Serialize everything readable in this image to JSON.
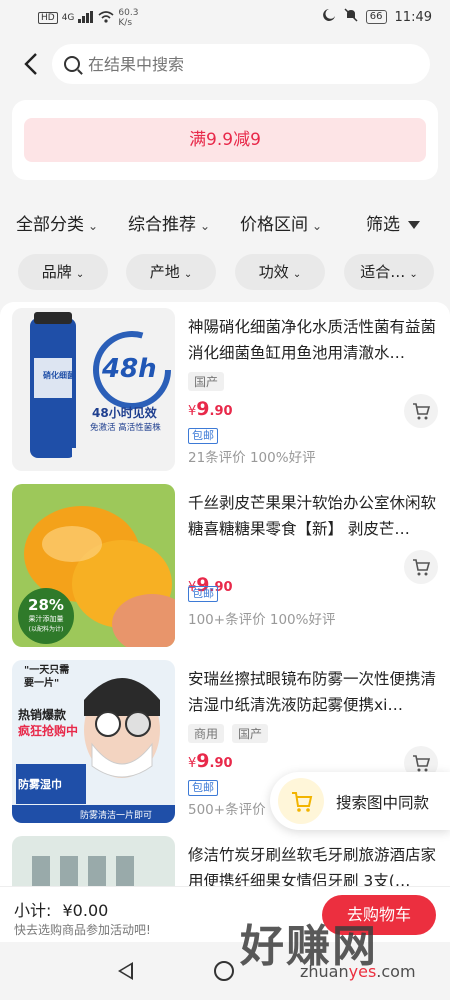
{
  "status_bar": {
    "network": "HD",
    "signal": "4G",
    "speed": "60.3",
    "speed_unit": "K/s",
    "battery": "66",
    "time": "11:49"
  },
  "search": {
    "placeholder": "在结果中搜索"
  },
  "promo_banner": "满9.9减9",
  "sort": {
    "category": "全部分类",
    "recommend": "综合推荐",
    "price_range": "价格区间",
    "filter": "筛选"
  },
  "chips": [
    "品牌",
    "产地",
    "功效",
    "适合…"
  ],
  "products": [
    {
      "title": "神陽硝化细菌净化水质活性菌有益菌消化细菌鱼缸用鱼池用清澈水…",
      "tags": [
        "国产"
      ],
      "price_yen": "¥",
      "price_int": "9",
      "price_dec": ".90",
      "shipping": "包邮",
      "reviews": "21条评价  100%好评",
      "image_text": {
        "badge": "48h",
        "caption": "48小时见效",
        "sub": "免激活  高活性菌株",
        "can": "硝化细菌"
      }
    },
    {
      "title": "千丝剥皮芒果果汁软饴办公室休闲软糖喜糖糖果零食【新】 剥皮芒…",
      "tags": [],
      "price_yen": "¥",
      "price_int": "9",
      "price_dec": ".90",
      "shipping": "包邮",
      "reviews": "100+条评价  100%好评",
      "image_text": {
        "percent": "28%",
        "caption": "果汁添加量",
        "sub": "(以配料为计)"
      }
    },
    {
      "title": "安瑞丝擦拭眼镜布防雾一次性便携清洁湿巾纸清洗液防起雾便携xi…",
      "tags": [
        "商用",
        "国产"
      ],
      "price_yen": "¥",
      "price_int": "9",
      "price_dec": ".90",
      "shipping": "包邮",
      "reviews": "500+条评价",
      "image_text": {
        "quote": "\"一天只需要一片\"",
        "hot": "热销爆款",
        "grab": "疯狂抢购中",
        "mist": "防雾湿巾",
        "bottom": "防雾清洁一片即可"
      }
    },
    {
      "title": "修洁竹炭牙刷丝软毛牙刷旅游酒店家用便携纤细果女情侣牙刷 3支(…",
      "tags": [],
      "price_yen": "",
      "price_int": "",
      "price_dec": "",
      "shipping": "",
      "reviews": "",
      "image_text": {}
    }
  ],
  "float_search": "搜索图中同款",
  "footer": {
    "subtotal_label": "小计:",
    "subtotal_value": "¥0.00",
    "hint": "快去选购商品参加活动吧!",
    "go_cart": "去购物车"
  },
  "watermark": {
    "main": "好赚网",
    "sub_prefix": "zhuan",
    "sub_accent": "yes",
    "sub_suffix": ".com"
  },
  "colors": {
    "accent": "#e8294a",
    "promo_bg": "#fde4e6",
    "shipping_blue": "#3d7ad6",
    "cart_button": "#ec2f3f"
  }
}
